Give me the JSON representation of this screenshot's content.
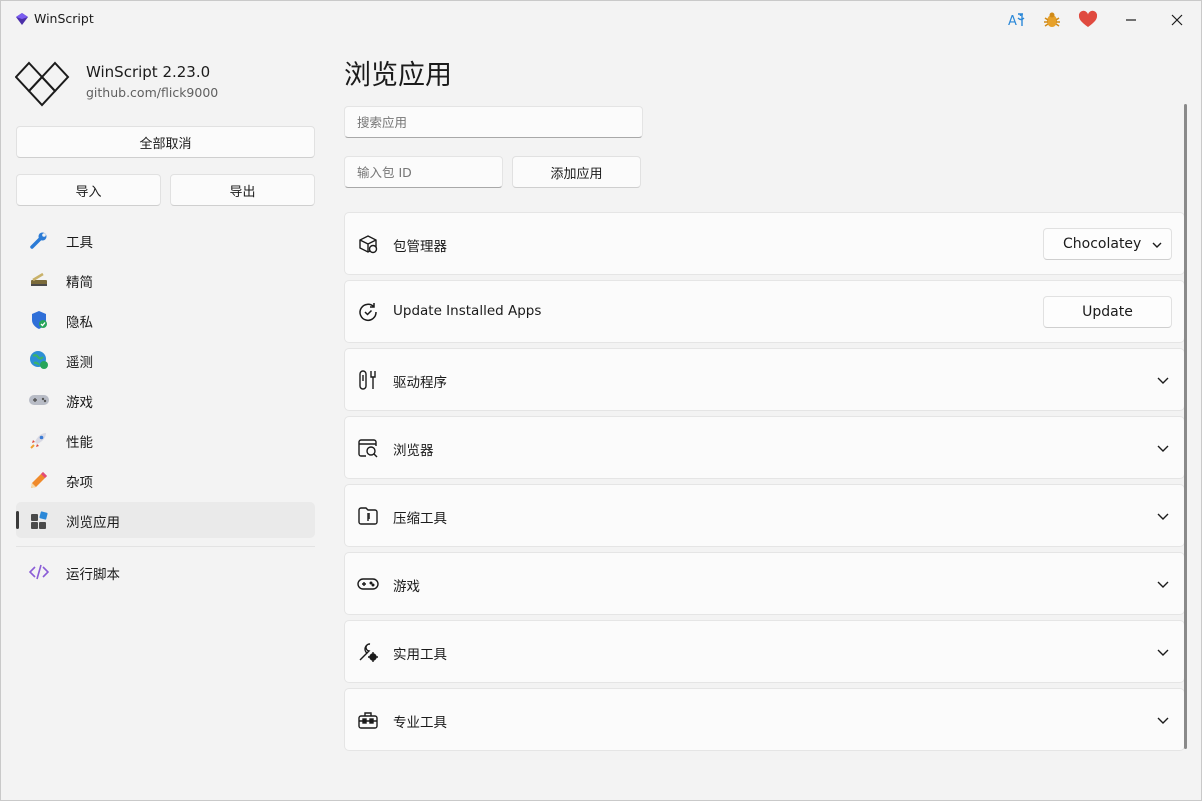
{
  "window": {
    "title": "WinScript"
  },
  "app": {
    "name": "WinScript 2.23.0",
    "link": "github.com/flick9000"
  },
  "sidebar": {
    "deselect_all": "全部取消",
    "import": "导入",
    "export": "导出",
    "items": [
      {
        "label": "工具",
        "icon": "wrench-icon"
      },
      {
        "label": "精简",
        "icon": "broom-icon"
      },
      {
        "label": "隐私",
        "icon": "shield-icon"
      },
      {
        "label": "遥测",
        "icon": "globe-icon"
      },
      {
        "label": "游戏",
        "icon": "gamepad-icon"
      },
      {
        "label": "性能",
        "icon": "rocket-icon"
      },
      {
        "label": "杂项",
        "icon": "pencil-icon"
      },
      {
        "label": "浏览应用",
        "icon": "apps-icon",
        "active": true
      }
    ],
    "run_script": "运行脚本"
  },
  "main": {
    "title": "浏览应用",
    "search_placeholder": "搜索应用",
    "package_id_placeholder": "输入包 ID",
    "add_app": "添加应用",
    "package_manager": {
      "label": "包管理器",
      "value": "Chocolatey"
    },
    "update": {
      "label": "Update Installed Apps",
      "button": "Update"
    },
    "categories": [
      "驱动程序",
      "浏览器",
      "压缩工具",
      "游戏",
      "实用工具",
      "专业工具"
    ]
  },
  "colors": {
    "accent_purple": "#5b3fd6",
    "heart": "#e04a3f",
    "bug": "#e7a12a",
    "translate": "#2b88d8"
  }
}
